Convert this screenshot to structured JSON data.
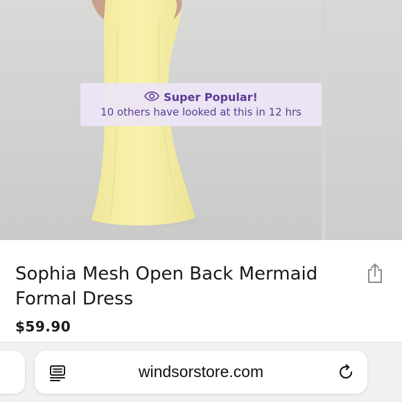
{
  "gallery": {
    "badge": {
      "icon": "eye-icon",
      "title": "Super Popular!",
      "subtitle": "10 others have looked at this in 12 hrs"
    }
  },
  "product": {
    "title": "Sophia Mesh Open Back Mermaid Formal Dress",
    "price": "$59.90",
    "share_icon": "share-icon"
  },
  "browser": {
    "url": "windsorstore.com",
    "reader_icon": "reader-mode-icon",
    "reload_icon": "reload-icon"
  },
  "colors": {
    "badge_text": "#5b3b93",
    "badge_background": "#ece5f6",
    "dress": "#f6f0a6"
  }
}
